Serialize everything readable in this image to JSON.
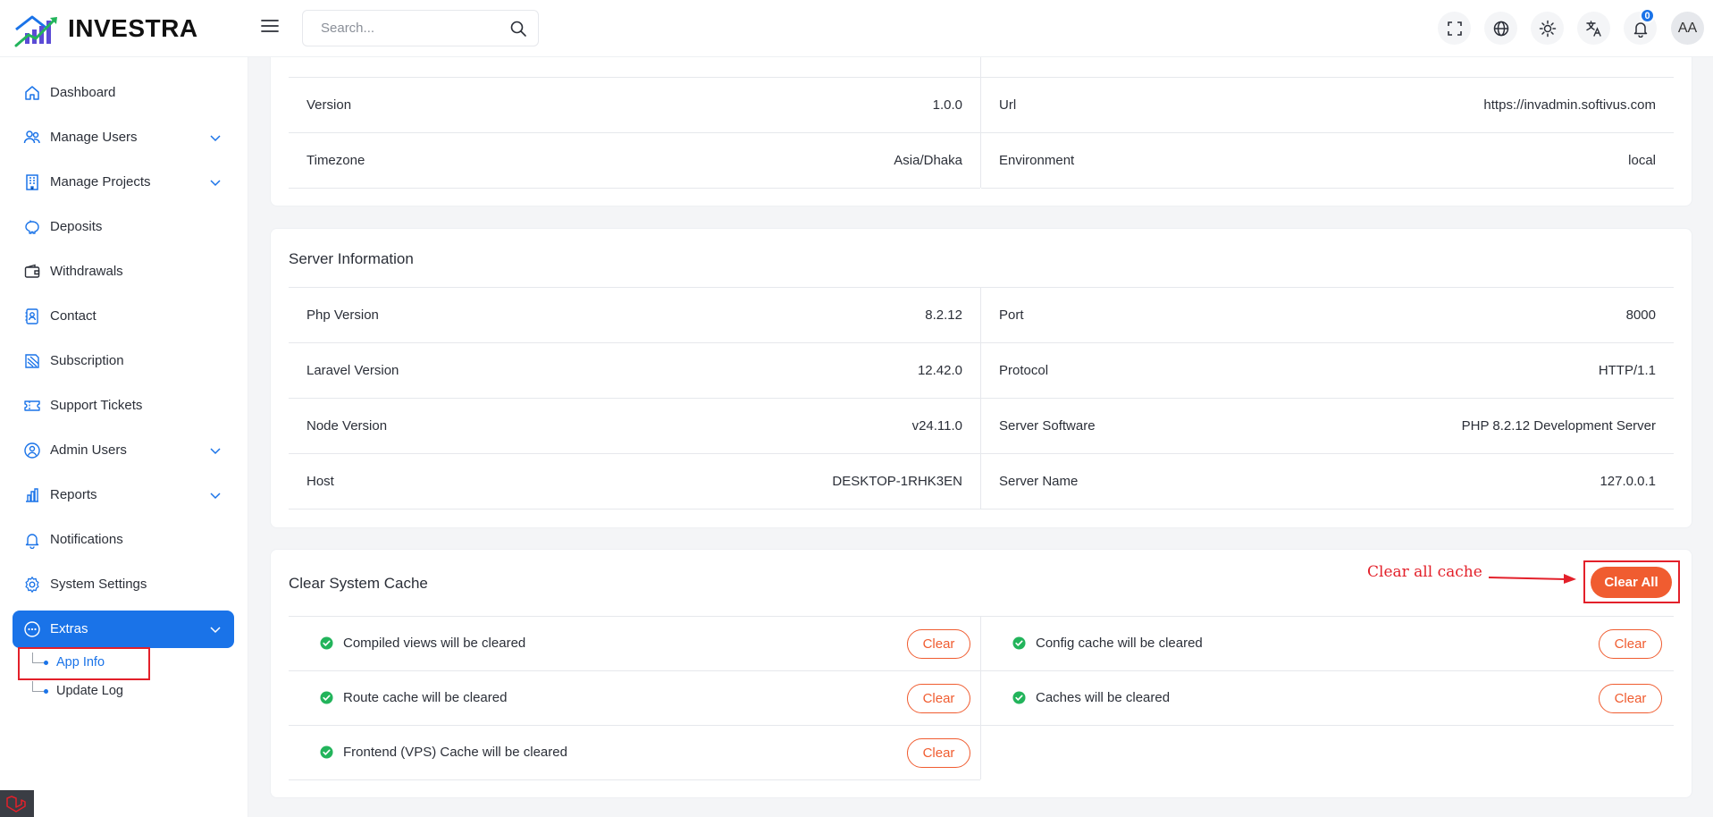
{
  "brand": {
    "name": "INVESTRA"
  },
  "header": {
    "search_placeholder": "Search...",
    "notification_count": "0",
    "avatar_initials": "AA"
  },
  "sidebar": {
    "items": [
      {
        "label": "Dashboard",
        "icon": "home-icon",
        "has_children": false
      },
      {
        "label": "Manage Users",
        "icon": "users-icon",
        "has_children": true
      },
      {
        "label": "Manage Projects",
        "icon": "building-icon",
        "has_children": true
      },
      {
        "label": "Deposits",
        "icon": "piggy-bank-icon",
        "has_children": false
      },
      {
        "label": "Withdrawals",
        "icon": "wallet-icon",
        "has_children": false
      },
      {
        "label": "Contact",
        "icon": "contact-icon",
        "has_children": false
      },
      {
        "label": "Subscription",
        "icon": "subscription-icon",
        "has_children": false
      },
      {
        "label": "Support Tickets",
        "icon": "ticket-icon",
        "has_children": false
      },
      {
        "label": "Admin Users",
        "icon": "admin-user-icon",
        "has_children": true
      },
      {
        "label": "Reports",
        "icon": "chart-icon",
        "has_children": true
      },
      {
        "label": "Notifications",
        "icon": "bell-icon",
        "has_children": false
      },
      {
        "label": "System Settings",
        "icon": "gear-icon",
        "has_children": false
      },
      {
        "label": "Extras",
        "icon": "dots-circle-icon",
        "has_children": true,
        "active": true
      }
    ],
    "extras_children": [
      {
        "label": "App Info",
        "active": true
      },
      {
        "label": "Update Log",
        "active": false
      }
    ]
  },
  "app_info": {
    "rows": [
      {
        "left_key": "Version",
        "left_value": "1.0.0",
        "right_key": "Url",
        "right_value": "https://invadmin.softivus.com"
      },
      {
        "left_key": "Timezone",
        "left_value": "Asia/Dhaka",
        "right_key": "Environment",
        "right_value": "local"
      }
    ]
  },
  "server_info": {
    "title": "Server Information",
    "rows": [
      {
        "left_key": "Php Version",
        "left_value": "8.2.12",
        "right_key": "Port",
        "right_value": "8000"
      },
      {
        "left_key": "Laravel Version",
        "left_value": "12.42.0",
        "right_key": "Protocol",
        "right_value": "HTTP/1.1"
      },
      {
        "left_key": "Node Version",
        "left_value": "v24.11.0",
        "right_key": "Server Software",
        "right_value": "PHP 8.2.12 Development Server"
      },
      {
        "left_key": "Host",
        "left_value": "DESKTOP-1RHK3EN",
        "right_key": "Server Name",
        "right_value": "127.0.0.1"
      }
    ]
  },
  "cache": {
    "title": "Clear System Cache",
    "clear_all_label": "Clear All",
    "clear_label": "Clear",
    "annotation": "Clear all cache",
    "items_left": [
      "Compiled views will be cleared",
      "Route cache will be cleared",
      "Frontend (VPS) Cache will be cleared"
    ],
    "items_right": [
      "Config cache will be cleared",
      "Caches will be cleared"
    ]
  },
  "colors": {
    "primary": "#1a73e8",
    "accent": "#f05c30",
    "success": "#22b45b",
    "annotation": "#e3202a"
  }
}
